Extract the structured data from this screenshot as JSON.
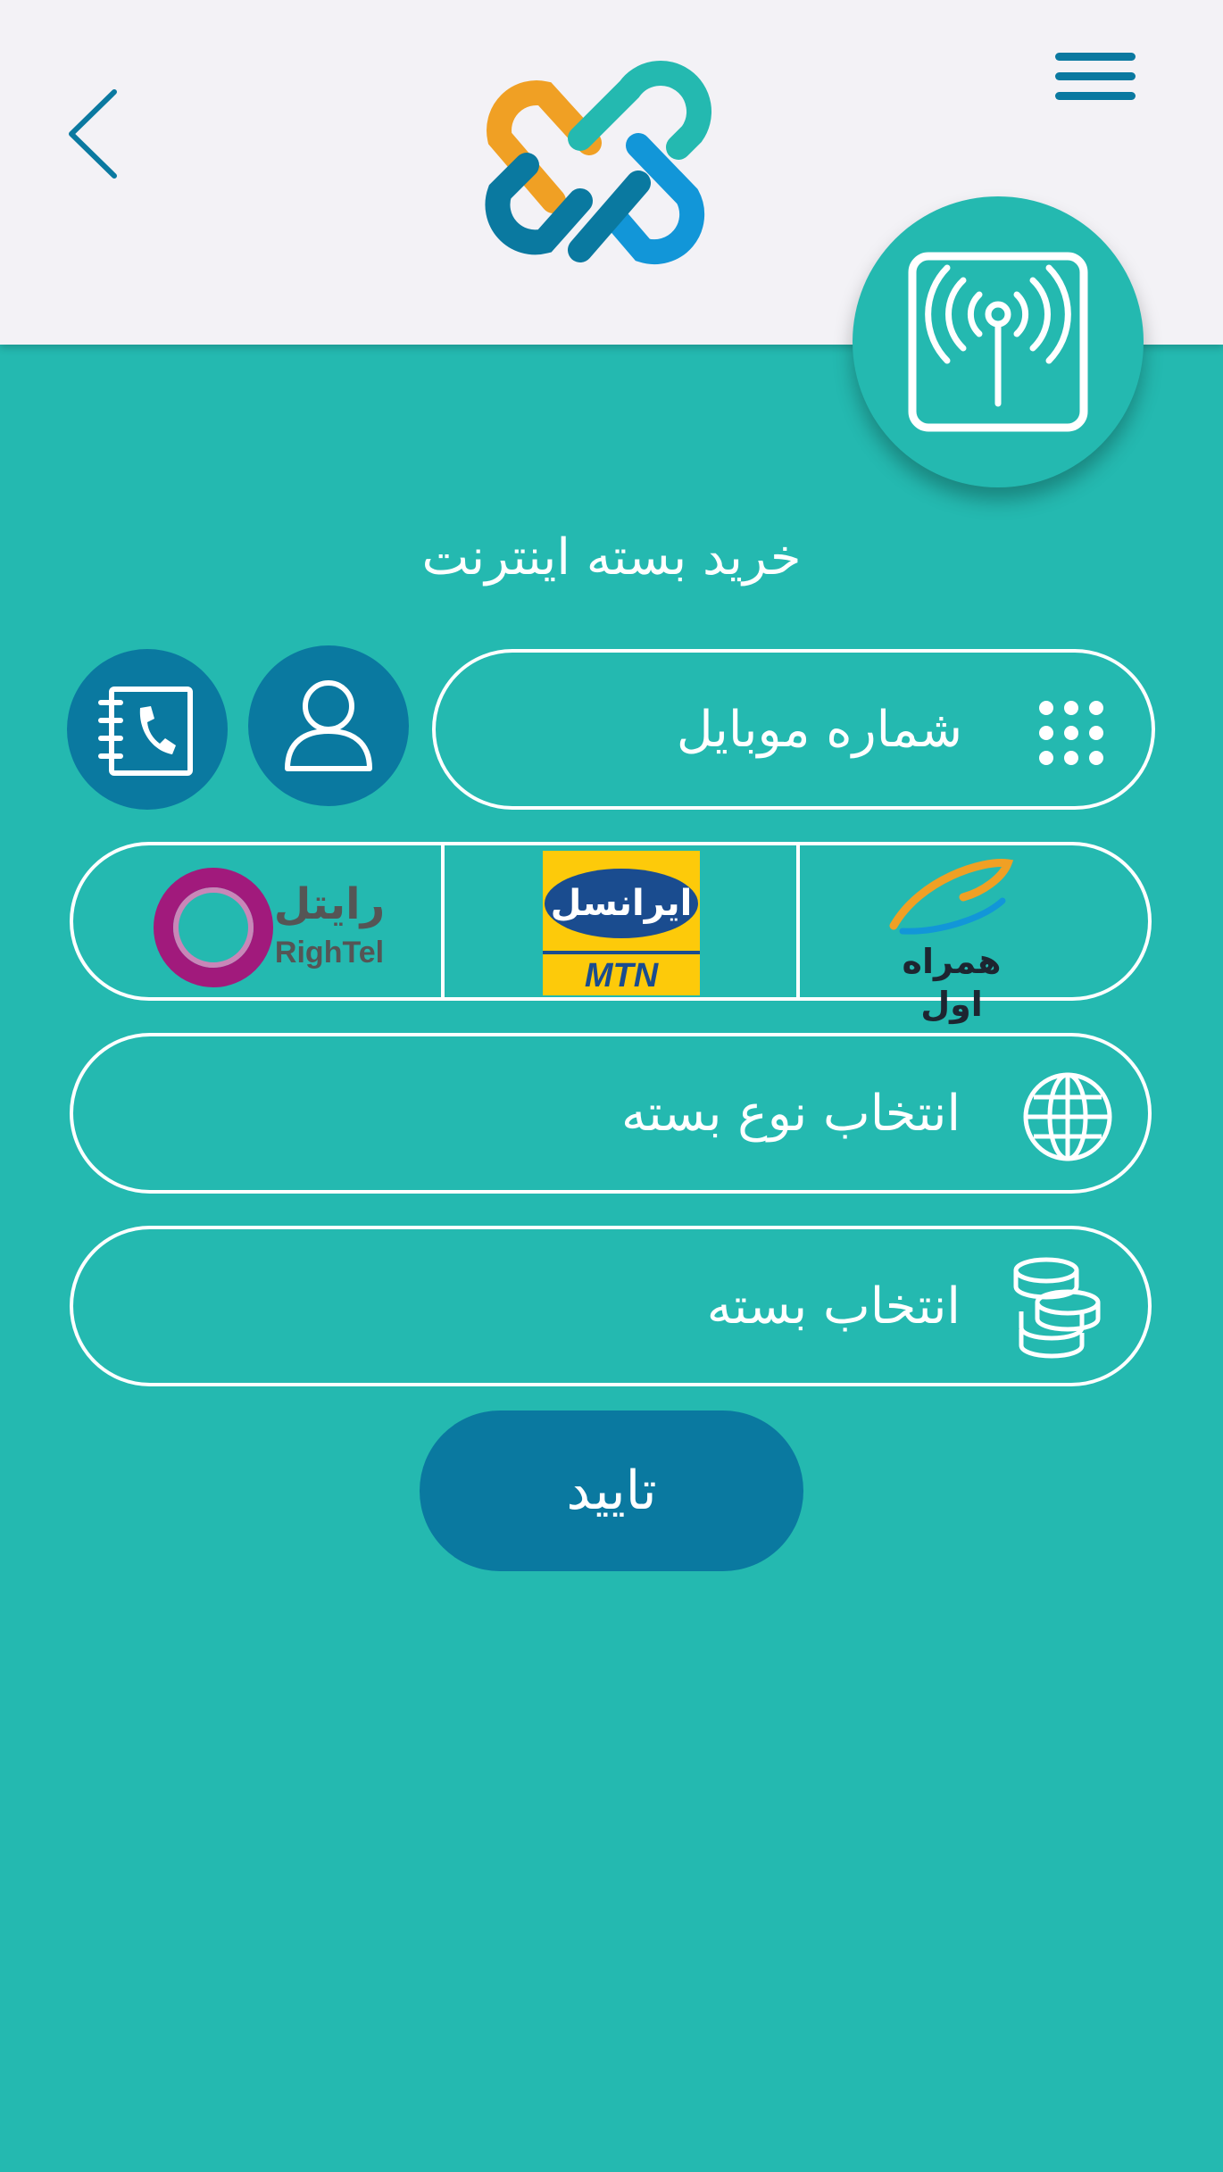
{
  "header": {
    "back_icon": "chevron-left-icon",
    "menu_icon": "hamburger-menu-icon",
    "logo": "interlocked-links-logo",
    "service_icon": "antenna-signal-icon"
  },
  "page_title": "خرید بسته اینترنت",
  "mobile": {
    "placeholder": "شماره موبایل",
    "keypad_icon": "keypad-icon",
    "contact_icon": "user-icon",
    "phonebook_icon": "phonebook-icon"
  },
  "operators": [
    {
      "name": "همراه اول",
      "id": "mci"
    },
    {
      "name": "ایرانسل",
      "sub": "MTN",
      "id": "irancell"
    },
    {
      "name": "رایتل",
      "sub": "RighTel",
      "id": "rightel"
    }
  ],
  "package_type": {
    "label": "انتخاب نوع بسته",
    "icon": "globe-icon"
  },
  "package": {
    "label": "انتخاب بسته",
    "icon": "coins-icon"
  },
  "confirm_label": "تایید",
  "colors": {
    "teal": "#24b9b0",
    "blue": "#0a79a0",
    "header_bg": "#f3f2f6",
    "orange": "#f0a024",
    "light_blue": "#1296d8"
  }
}
